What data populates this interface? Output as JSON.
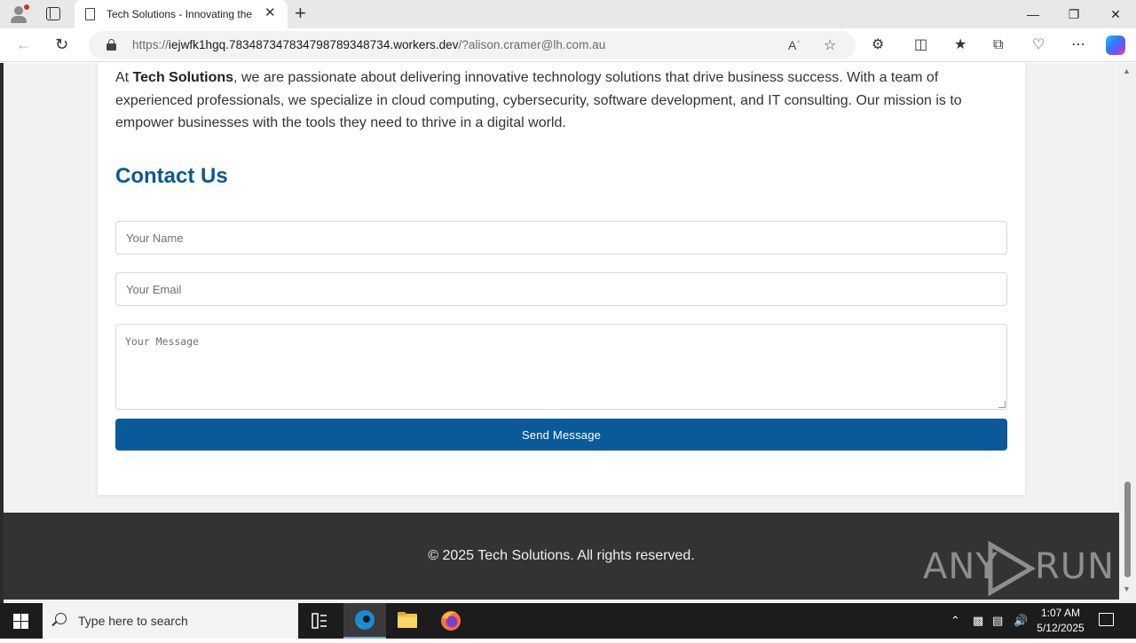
{
  "browser": {
    "tab_title": "Tech Solutions - Innovating the F",
    "url_scheme": "https://",
    "url_host": "iejwfk1hgq.783487347834798789348734.workers.dev",
    "url_rest": "/?alison.cramer@lh.com.au",
    "new_tab": "+",
    "close_tab": "✕"
  },
  "page": {
    "about_prefix": "At ",
    "about_brand": "Tech Solutions",
    "about_text": ", we are passionate about delivering innovative technology solutions that drive business success. With a team of experienced professionals, we specialize in cloud computing, cybersecurity, software development, and IT consulting. Our mission is to empower businesses with the tools they need to thrive in a digital world.",
    "contact_heading": "Contact Us",
    "name_placeholder": "Your Name",
    "email_placeholder": "Your Email",
    "message_placeholder": "Your Message",
    "send_label": "Send Message",
    "footer_text": "© 2025 Tech Solutions. All rights reserved."
  },
  "watermark": {
    "left": "ANY",
    "right": "RUN"
  },
  "taskbar": {
    "search_placeholder": "Type here to search",
    "time": "1:07 AM",
    "date": "5/12/2025"
  },
  "colors": {
    "heading": "#0b5a8e",
    "button": "#0a5a9a",
    "footer": "#333333"
  }
}
